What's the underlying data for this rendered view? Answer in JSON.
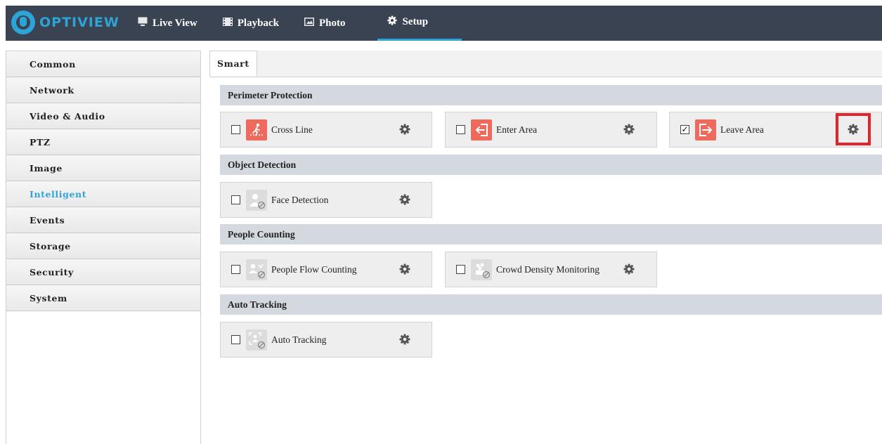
{
  "brand": {
    "name": "OPTIVIEW"
  },
  "nav": [
    {
      "label": "Live View",
      "icon": "monitor-icon"
    },
    {
      "label": "Playback",
      "icon": "film-icon"
    },
    {
      "label": "Photo",
      "icon": "picture-icon"
    },
    {
      "label": "Setup",
      "icon": "gear-icon",
      "active": true
    }
  ],
  "sidebar": {
    "items": [
      {
        "label": "Common"
      },
      {
        "label": "Network"
      },
      {
        "label": "Video & Audio"
      },
      {
        "label": "PTZ"
      },
      {
        "label": "Image"
      },
      {
        "label": "Intelligent",
        "active": true
      },
      {
        "label": "Events"
      },
      {
        "label": "Storage"
      },
      {
        "label": "Security"
      },
      {
        "label": "System"
      }
    ]
  },
  "tabs": [
    {
      "label": "Smart",
      "active": true
    }
  ],
  "sections": [
    {
      "title": "Perimeter Protection",
      "features": [
        {
          "label": "Cross Line",
          "checked": false,
          "icon": "cross-line-icon"
        },
        {
          "label": "Enter Area",
          "checked": false,
          "icon": "enter-area-icon"
        },
        {
          "label": "Leave Area",
          "checked": true,
          "icon": "leave-area-icon"
        }
      ]
    },
    {
      "title": "Object Detection",
      "features": [
        {
          "label": "Face Detection",
          "checked": false,
          "icon": "face-detection-icon"
        }
      ]
    },
    {
      "title": "People Counting",
      "features": [
        {
          "label": "People Flow Counting",
          "checked": false,
          "icon": "people-flow-icon"
        },
        {
          "label": "Crowd Density Monitoring",
          "checked": false,
          "icon": "crowd-density-icon"
        }
      ]
    },
    {
      "title": "Auto Tracking",
      "features": [
        {
          "label": "Auto Tracking",
          "checked": false,
          "icon": "auto-tracking-icon"
        }
      ]
    }
  ],
  "colors": {
    "topbar": "#3a4352",
    "accent": "#2da4d8",
    "feature_red": "#ee6a5d",
    "highlight": "#e1232a"
  }
}
